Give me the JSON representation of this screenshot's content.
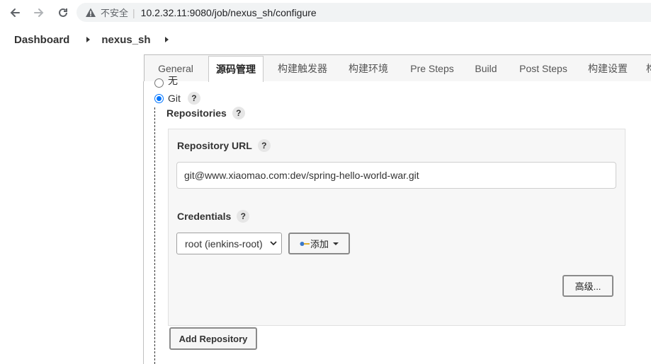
{
  "browser": {
    "insecure_label": "不安全",
    "separator": "|",
    "url": "10.2.32.11:9080/job/nexus_sh/configure"
  },
  "breadcrumb": {
    "items": [
      "Dashboard",
      "nexus_sh"
    ]
  },
  "tabs": [
    {
      "label": "General"
    },
    {
      "label": "源码管理"
    },
    {
      "label": "构建触发器"
    },
    {
      "label": "构建环境"
    },
    {
      "label": "Pre Steps"
    },
    {
      "label": "Build"
    },
    {
      "label": "Post Steps"
    },
    {
      "label": "构建设置"
    },
    {
      "label": "构"
    }
  ],
  "active_tab": "源码管理",
  "scm": {
    "option_none": "无",
    "option_git": "Git",
    "help_glyph": "?",
    "repositories_label": "Repositories",
    "repository_url_label": "Repository URL",
    "repository_url_value": "git@www.xiaomao.com:dev/spring-hello-world-war.git",
    "credentials_label": "Credentials",
    "credentials_selected": "root (ienkins-root)",
    "add_button_label": "添加",
    "advanced_button_label": "高级...",
    "add_repository_label": "Add Repository"
  },
  "colors": {
    "radio_accent": "#0075ff",
    "warning_icon": "#5f6368"
  }
}
